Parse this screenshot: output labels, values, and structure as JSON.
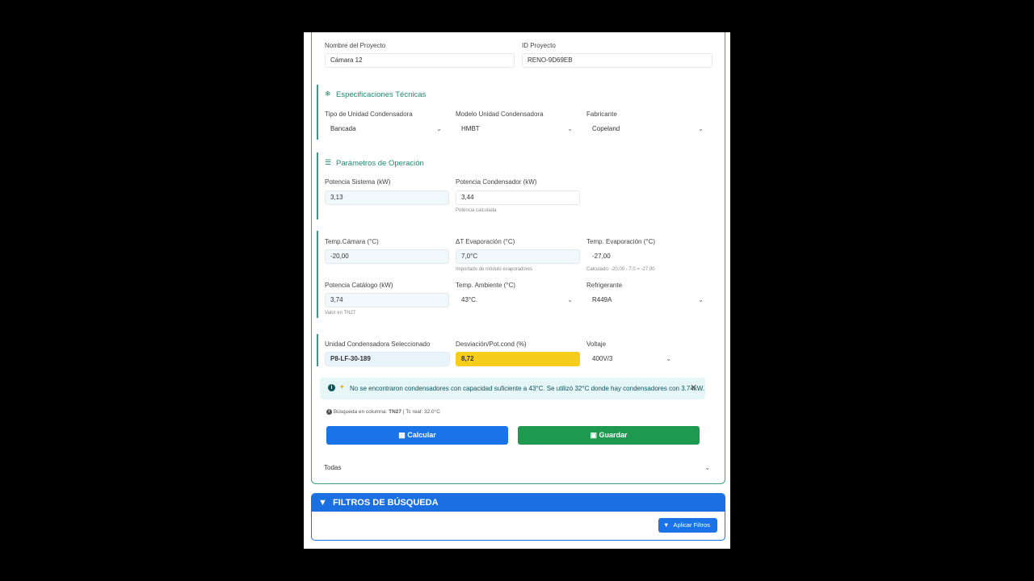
{
  "project": {
    "name_label": "Nombre del Proyecto",
    "name_value": "Cámara 12",
    "id_label": "ID Proyecto",
    "id_value": "RENO-9D69EB"
  },
  "specs": {
    "title": "Especificaciones Técnicas",
    "icon": "snowflake-icon",
    "unit_type_label": "Tipo de Unidad Condensadora",
    "unit_type_value": "Bancada",
    "model_label": "Modelo Unidad Condensadora",
    "model_value": "HMBT",
    "maker_label": "Fabricante",
    "maker_value": "Copeland"
  },
  "operation": {
    "title": "Parámetros de Operación",
    "icon": "sliders-icon",
    "system_power_label": "Potencia Sistema (kW)",
    "system_power_value": "3,13",
    "condenser_power_label": "Potencia Condensador (kW)",
    "condenser_power_value": "3,44",
    "condenser_power_hint": "Potencia calculada"
  },
  "temps": {
    "chamber_label": "Temp.Cámara (°C)",
    "chamber_value": "-20,00",
    "delta_label": "ΔT Evaporación (°C)",
    "delta_value": "7,0°C",
    "delta_hint": "Importado de módulo evaporadores",
    "evap_label": "Temp. Evaporación (°C)",
    "evap_value": "-27,00",
    "evap_hint": "Calculado: -20,00 - 7,0 = -27,00",
    "catalog_label": "Potencia Catálogo (kW)",
    "catalog_value": "3,74",
    "catalog_hint": "Valor en TN27",
    "ambient_label": "Temp. Ambiente (°C)",
    "ambient_value": "43°C.",
    "refrigerant_label": "Refrigerante",
    "refrigerant_value": "R449A"
  },
  "selection": {
    "unit_label": "Unidad Condensadora Seleccionado",
    "unit_value": "P8-LF-30-189",
    "deviation_label": "Desviación/Pot.cond (%)",
    "deviation_value": "8,72",
    "deviation_color": "#f5cd1a",
    "voltage_label": "Voltaje",
    "voltage_value": "400V/3"
  },
  "alert": {
    "text": "No se encontraron condensadores con capacidad suficiente a 43°C. Se utilizó 32°C donde hay condensadores con 3.74kW."
  },
  "search_info": {
    "prefix": "Búsqueda en columna:",
    "column": "TN27",
    "suffix": "| Tc real: 32.0°C"
  },
  "buttons": {
    "calculate": "Calcular",
    "save": "Guardar"
  },
  "all_select": "Todas",
  "filters": {
    "title": "FILTROS DE BÚSQUEDA",
    "apply": "Aplicar Filtros"
  },
  "colors": {
    "accent_green": "#1e8a6e",
    "primary_blue": "#1b73e8",
    "success_green": "#1d9a4f",
    "alert_bg": "#e6f6f6"
  }
}
